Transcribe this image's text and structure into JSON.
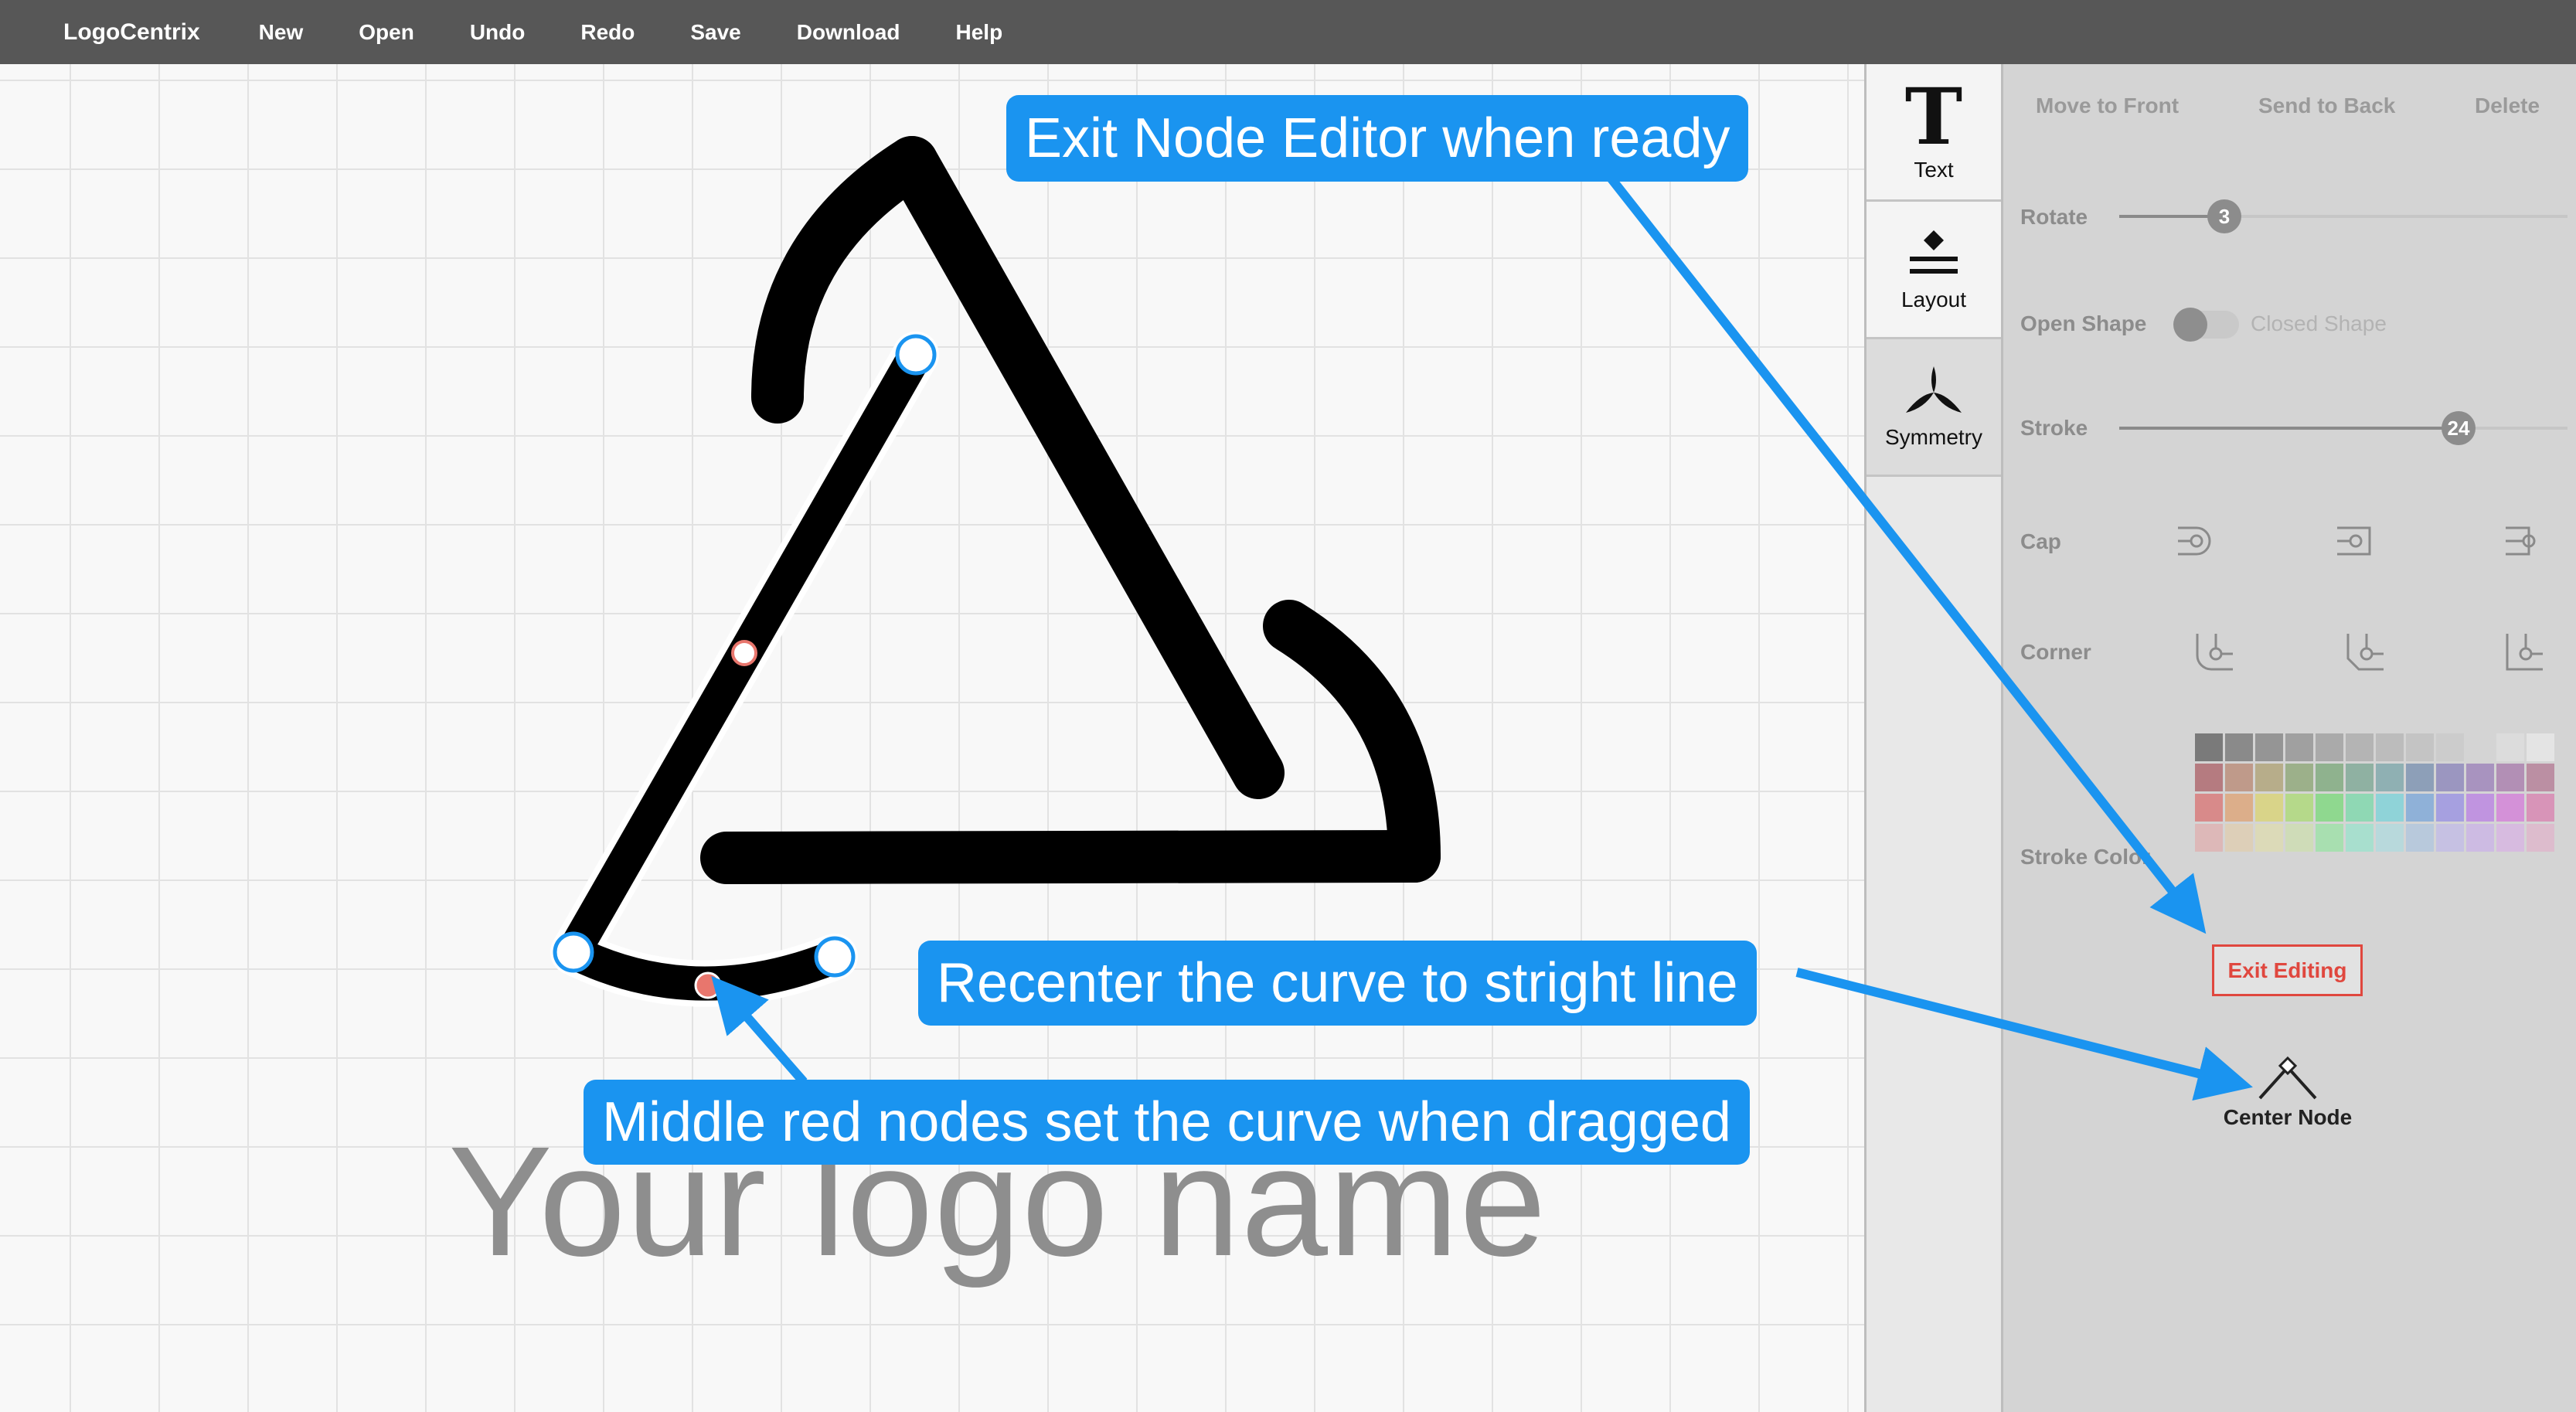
{
  "menubar": {
    "brand": "LogoCentrix",
    "items": [
      "New",
      "Open",
      "Undo",
      "Redo",
      "Save",
      "Download",
      "Help"
    ]
  },
  "canvas": {
    "logo_name": "Your logo name"
  },
  "toolstrip": {
    "tools": [
      {
        "label": "Text",
        "icon": "text-icon"
      },
      {
        "label": "Layout",
        "icon": "layout-icon"
      },
      {
        "label": "Symmetry",
        "icon": "symmetry-icon"
      }
    ],
    "text_glyph": "T"
  },
  "properties": {
    "actions": [
      "Move to Front",
      "Send to Back",
      "Delete"
    ],
    "rotate": {
      "label": "Rotate",
      "value": "3"
    },
    "shape_toggle": {
      "left": "Open Shape",
      "right": "Closed Shape"
    },
    "stroke": {
      "label": "Stroke",
      "value": "24"
    },
    "cap": {
      "label": "Cap",
      "options": [
        "round-cap-icon",
        "square-cap-icon",
        "butt-cap-icon"
      ]
    },
    "corner": {
      "label": "Corner",
      "options": [
        "round-corner-icon",
        "bevel-corner-icon",
        "miter-corner-icon"
      ]
    },
    "stroke_color": {
      "label": "Stroke Color"
    },
    "exit_button": "Exit Editing",
    "center_node": "Center Node"
  },
  "palette": [
    [
      "#7a7a7a",
      "#8a8a8a",
      "#959595",
      "#a0a0a0",
      "#aaaaaa",
      "#b4b4b4",
      "#bcbcbc",
      "#c4c4c4",
      "#cccccc",
      "#d4d4d4",
      "#dcdcdc",
      "#e4e4e4"
    ],
    [
      "#b57b80",
      "#bf9a8a",
      "#b7ad8a",
      "#9cb08a",
      "#8fb28e",
      "#8fb1a2",
      "#8fb0b3",
      "#8d9fb8",
      "#9b96c0",
      "#a893bf",
      "#b28fb5",
      "#bb8fa3"
    ],
    [
      "#d88a8a",
      "#dcae8a",
      "#d9d489",
      "#b5d98a",
      "#8fd88f",
      "#8fd8b4",
      "#8fd3d8",
      "#8fb1d8",
      "#a6a0e0",
      "#c094e0",
      "#d491d8",
      "#d894b8"
    ],
    [
      "#ddb8b8",
      "#ddcfb8",
      "#dcdab8",
      "#cfdcb8",
      "#a8dfb0",
      "#a8dfce",
      "#b8d9dc",
      "#b8c9dc",
      "#c6c1e3",
      "#cdbbe3",
      "#d7bbe0",
      "#ddbccd"
    ]
  ],
  "callouts": {
    "exit": "Exit Node Editor when ready",
    "recenter": "Recenter the curve to stright line",
    "middle": "Middle red nodes set the curve when dragged"
  },
  "colors": {
    "accent": "#1a94f0",
    "danger": "#e0473e",
    "node_red": "#e8766d",
    "menubar": "#575757"
  }
}
